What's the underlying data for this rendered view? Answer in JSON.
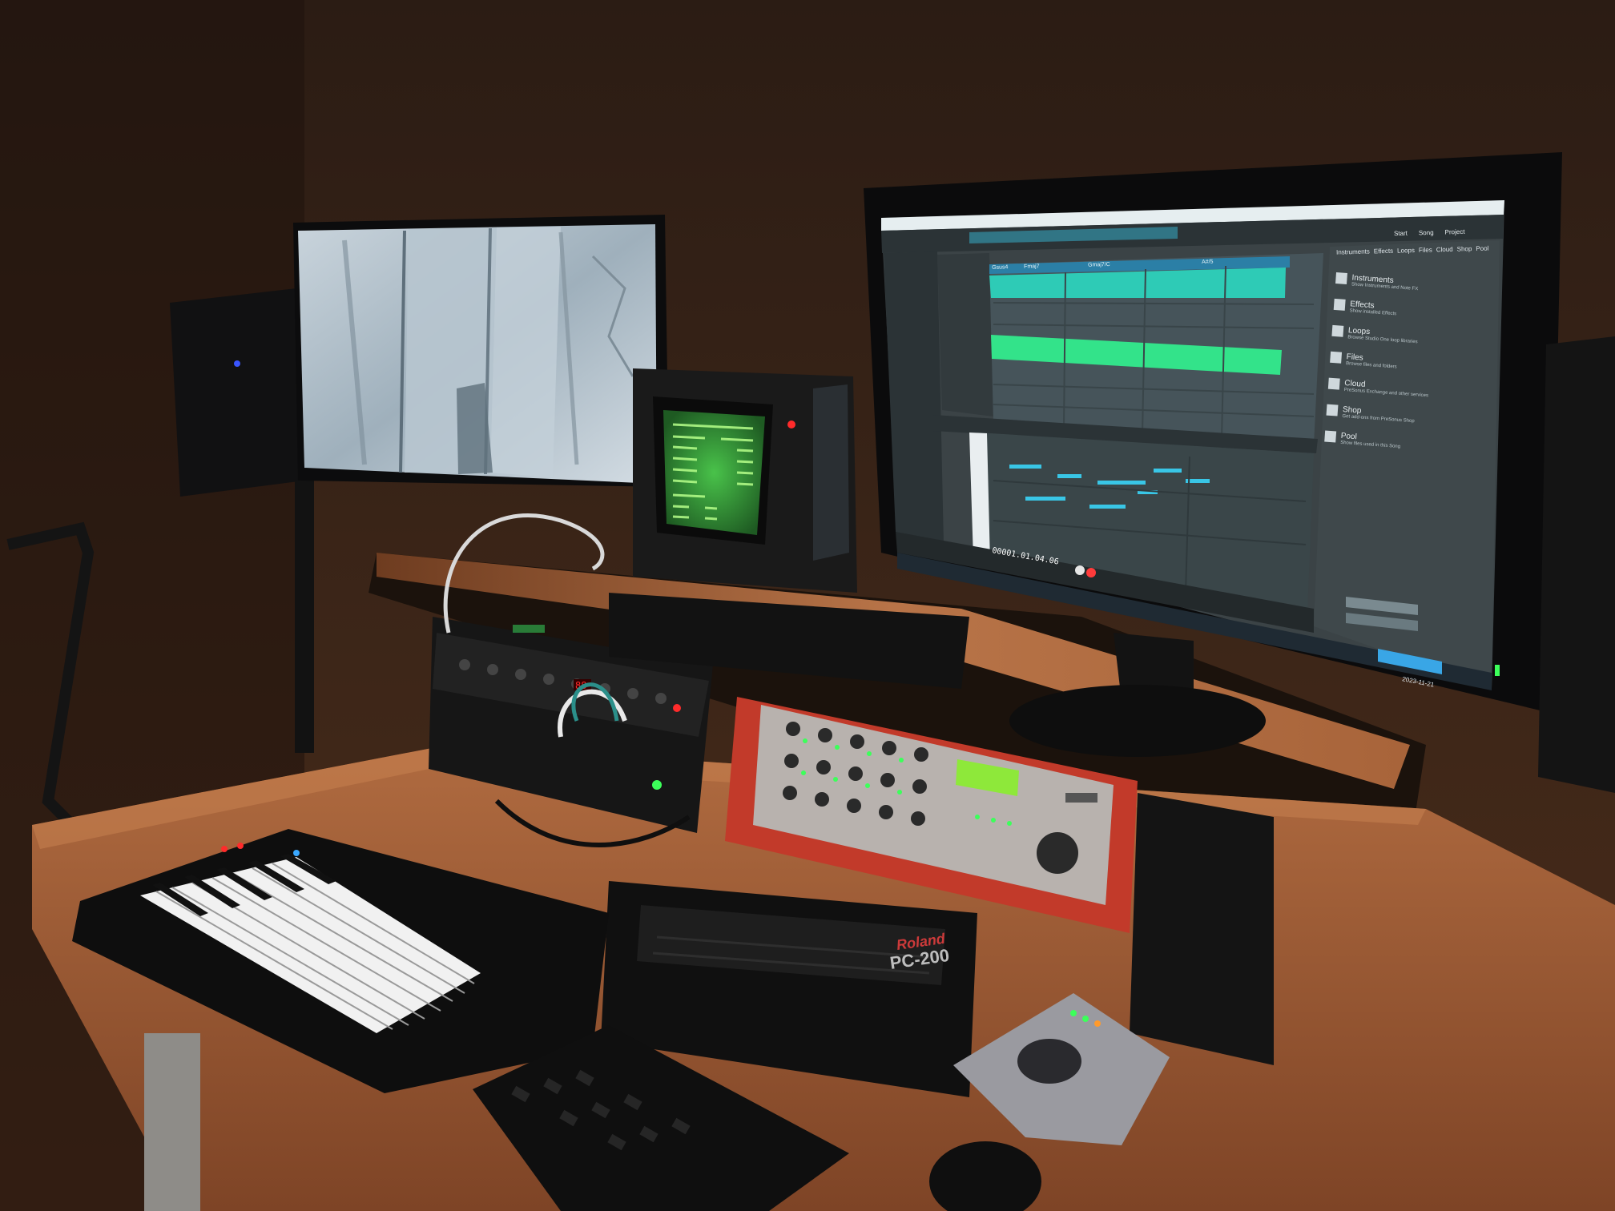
{
  "photo": {
    "palette": {
      "wall_top": "#33231a",
      "wall_bottom": "#4a2e1c",
      "desk": "#a8643a",
      "desk_dark": "#7a4424",
      "shelf": "#b8744a",
      "daw_bg": "#3b4346",
      "daw_panel": "#2b3336",
      "daw_accent": "#2fd6a6",
      "daw_cyan": "#39c6e6",
      "crt_green": "#3be04c",
      "lcd_green": "#8ee83a",
      "synth_red": "#c23a2a",
      "synth_panel": "#b8b2ae",
      "led_red": "#ff2b2b",
      "led_green": "#3cff5a"
    }
  },
  "daw": {
    "browser_tabs": [
      "Instruments",
      "Effects",
      "Loops",
      "Files",
      "Cloud",
      "Shop",
      "Pool"
    ],
    "browser_items": [
      {
        "title": "Instruments",
        "subtitle": "Show Instruments and Note FX",
        "icon": "piano-icon"
      },
      {
        "title": "Effects",
        "subtitle": "Show installed Effects",
        "icon": "fx-icon"
      },
      {
        "title": "Loops",
        "subtitle": "Browse Studio One loop libraries",
        "icon": "loop-icon"
      },
      {
        "title": "Files",
        "subtitle": "Browse files and folders",
        "icon": "files-icon"
      },
      {
        "title": "Cloud",
        "subtitle": "PreSonus Exchange and other services",
        "icon": "cloud-icon"
      },
      {
        "title": "Shop",
        "subtitle": "Get add-ons from PreSonus Shop",
        "icon": "shop-icon"
      },
      {
        "title": "Pool",
        "subtitle": "Show files used in this Song",
        "icon": "pool-icon"
      }
    ],
    "top_buttons": [
      "Start",
      "Song",
      "Project"
    ],
    "marker_labels": [
      "Gsus4",
      "Fmaj7",
      "Gmaj7/C",
      "A#/5"
    ],
    "timecode": "00001.01.04.06",
    "date": "2023-11-21"
  },
  "hardware": {
    "synth_brand": "Roland",
    "synth_model": "PC-200"
  }
}
